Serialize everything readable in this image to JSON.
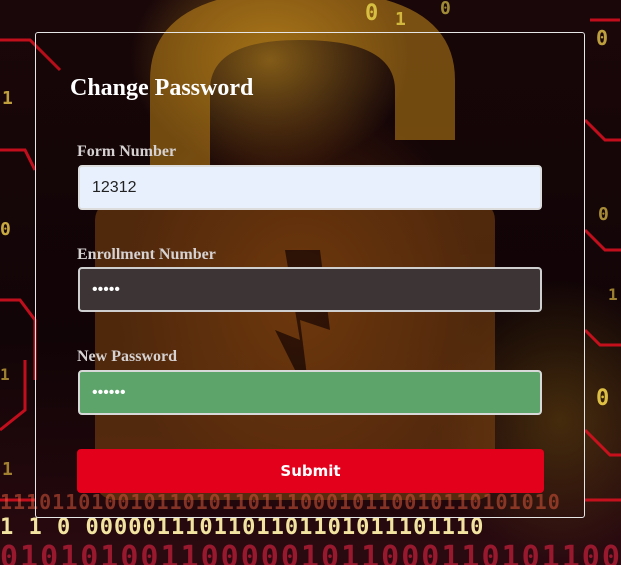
{
  "page": {
    "title": "Change Password"
  },
  "form": {
    "form_number": {
      "label": "Form Number",
      "value": "12312"
    },
    "enrollment_number": {
      "label": "Enrollment Number",
      "value": "•••••"
    },
    "new_password": {
      "label": "New Password",
      "value": "••••••"
    },
    "submit_label": "Submit"
  },
  "colors": {
    "submit_button": "#e3001b",
    "form_number_field": "#e8f0fe",
    "enrollment_field": "#3d3535",
    "new_password_field": "#5ca46a"
  }
}
